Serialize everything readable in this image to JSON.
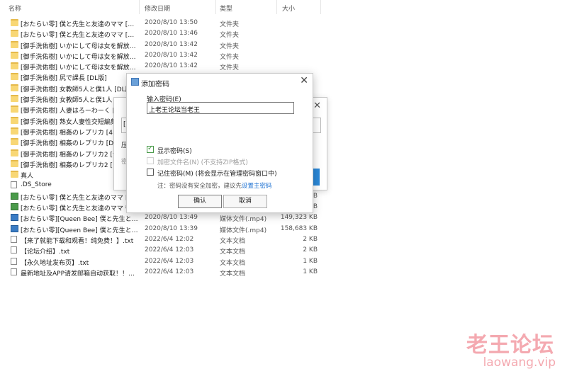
{
  "header": {
    "col_name": "名称",
    "col_date": "修改日期",
    "col_type": "类型",
    "col_size": "大小"
  },
  "files": [
    {
      "name": "[おたらい零] 僕と先生と友達のママ [含…",
      "date": "2020/8/10 13:50",
      "type": "文件夹",
      "size": "",
      "icon": "folder"
    },
    {
      "name": "[おたらい零] 僕と先生と友達のママ [日…",
      "date": "2020/8/10 13:46",
      "type": "文件夹",
      "size": "",
      "icon": "folder"
    },
    {
      "name": "[御手洗佑樹] いかにして母は女を解放し…",
      "date": "2020/8/10 13:42",
      "type": "文件夹",
      "size": "",
      "icon": "folder"
    },
    {
      "name": "[御手洗佑樹] いかにして母は女を解放し…",
      "date": "2020/8/10 13:42",
      "type": "文件夹",
      "size": "",
      "icon": "folder"
    },
    {
      "name": "[御手洗佑樹] いかにして母は女を解放し…",
      "date": "2020/8/10 13:42",
      "type": "文件夹",
      "size": "",
      "icon": "folder"
    },
    {
      "name": "[御手洗佑樹] 尻で課長 [DL版]",
      "date": "",
      "type": "",
      "size": "",
      "icon": "folder"
    },
    {
      "name": "[御手洗佑樹] 女教師5人と僕1人 [DL版",
      "date": "",
      "type": "",
      "size": "",
      "icon": "folder"
    },
    {
      "name": "[御手洗佑樹] 女教師5人と僕1人 [",
      "date": "",
      "type": "",
      "size": "",
      "icon": "folder"
    },
    {
      "name": "[御手洗佑樹] 人妻はろーわーく [",
      "date": "",
      "type": "",
      "size": "",
      "icon": "folder"
    },
    {
      "name": "[御手洗佑樹] 熟女人妻性交短編集",
      "date": "",
      "type": "",
      "size": "",
      "icon": "folder"
    },
    {
      "name": "[御手洗佑樹] 相姦のレプリカ [4K",
      "date": "",
      "type": "",
      "size": "",
      "icon": "folder"
    },
    {
      "name": "[御手洗佑樹] 相姦のレプリカ [DL",
      "date": "",
      "type": "",
      "size": "",
      "icon": "folder"
    },
    {
      "name": "[御手洗佑樹] 相姦のレプリカ2 [含",
      "date": "",
      "type": "",
      "size": "",
      "icon": "folder"
    },
    {
      "name": "[御手洗佑樹] 相姦のレプリカ2 [日",
      "date": "",
      "type": "",
      "size": "",
      "icon": "folder"
    },
    {
      "name": "真人",
      "date": "",
      "type": "",
      "size": "",
      "icon": "folder"
    },
    {
      "name": ".DS_Store",
      "date": "",
      "type": "",
      "size": "",
      "icon": "file"
    },
    {
      "name": "[おたらい零] 僕と先生と友達のママ 前",
      "date": "",
      "type": "",
      "size": "KB",
      "icon": "img"
    },
    {
      "name": "[おたらい零] 僕と先生と友達のママ 後",
      "date": "",
      "type": "",
      "size": "KB",
      "icon": "img"
    },
    {
      "name": "[おたらい零][Queen Bee] 僕と先生と友…",
      "date": "2020/8/10 13:49",
      "type": "媒体文件(.mp4)",
      "size": "149,323 KB",
      "icon": "vid"
    },
    {
      "name": "[おたらい零][Queen Bee] 僕と先生と友…",
      "date": "2020/8/10 13:39",
      "type": "媒体文件(.mp4)",
      "size": "158,683 KB",
      "icon": "vid"
    },
    {
      "name": "【来了就能下载和观看！纯免费！】.txt",
      "date": "2022/6/4 12:02",
      "type": "文本文档",
      "size": "2 KB",
      "icon": "file"
    },
    {
      "name": "【论坛介绍】.txt",
      "date": "2022/6/4 12:03",
      "type": "文本文档",
      "size": "2 KB",
      "icon": "file"
    },
    {
      "name": "【永久地址发布页】.txt",
      "date": "2022/6/4 12:03",
      "type": "文本文档",
      "size": "1 KB",
      "icon": "file"
    },
    {
      "name": "最新地址及APP请发邮箱自动获取！！！…",
      "date": "2022/6/4 12:03",
      "type": "文本文档",
      "size": "1 KB",
      "icon": "file"
    }
  ],
  "back_dialog": {
    "field_value": "[S",
    "label_1": "压",
    "label_2": "密"
  },
  "dialog": {
    "title": "添加密码",
    "close": "✕",
    "input_label": "输入密码(E)",
    "password_value": "上老王论坛当老王",
    "show_password": "显示密码(S)",
    "encrypt_filenames": "加密文件名(N) (不支持ZIP格式)",
    "remember_password": "记住密码(M) (将会显示在管理密码窗口中)",
    "note_prefix": "注：密码没有安全加密，建议先",
    "note_link": "设置主密码",
    "ok": "确认",
    "cancel": "取消"
  },
  "watermark": {
    "cn": "老王论坛",
    "url": "laowang.vip"
  }
}
